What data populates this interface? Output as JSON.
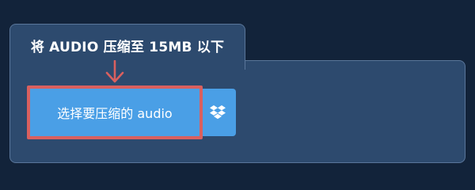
{
  "converter": {
    "title": "将 AUDIO 压缩至 15MB 以下",
    "upload_label": "选择要压缩的 audio",
    "dropbox_icon": "dropbox-icon",
    "pointer_icon": "arrow-down-icon"
  },
  "colors": {
    "page_bg": "#12233a",
    "panel_bg": "#2d4a6e",
    "button_bg": "#4a9fe6",
    "highlight": "#d9605f"
  }
}
